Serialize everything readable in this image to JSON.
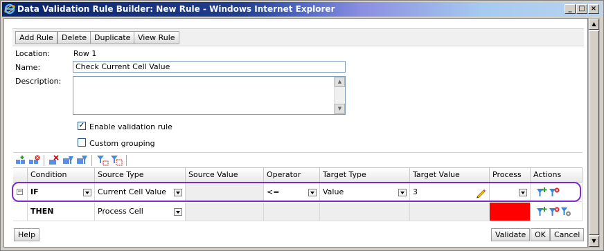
{
  "window": {
    "title": "Data Validation Rule Builder: New Rule - Windows Internet Explorer",
    "minimize": "_",
    "maximize": "□",
    "close": "×"
  },
  "toolbar": {
    "add_rule": "Add Rule",
    "delete": "Delete",
    "duplicate": "Duplicate",
    "view_rule": "View Rule"
  },
  "form": {
    "location_label": "Location:",
    "location_value": "Row 1",
    "name_label": "Name:",
    "name_value": "Check Current Cell Value",
    "description_label": "Description:",
    "description_value": "",
    "enable_label": "Enable validation rule",
    "enable_checked": "✓",
    "custom_grouping_label": "Custom grouping",
    "custom_grouping_checked": ""
  },
  "grid": {
    "columns": [
      "Condition",
      "Source Type",
      "Source Value",
      "Operator",
      "Target Type",
      "Target Value",
      "Process",
      "Actions"
    ],
    "rows": [
      {
        "expander": "−",
        "condition": "IF",
        "source_type": "Current Cell Value",
        "source_value": "",
        "operator": "<=",
        "target_type": "Value",
        "target_value": "3",
        "process": ""
      },
      {
        "condition": "THEN",
        "source_type": "Process Cell",
        "source_value": "",
        "operator": "",
        "target_type": "",
        "target_value": "",
        "process": ""
      }
    ]
  },
  "colors": {
    "highlight": "#7b2bd1",
    "process_red": "#ff0000"
  },
  "footer": {
    "help": "Help",
    "validate": "Validate",
    "ok": "OK",
    "cancel": "Cancel"
  }
}
